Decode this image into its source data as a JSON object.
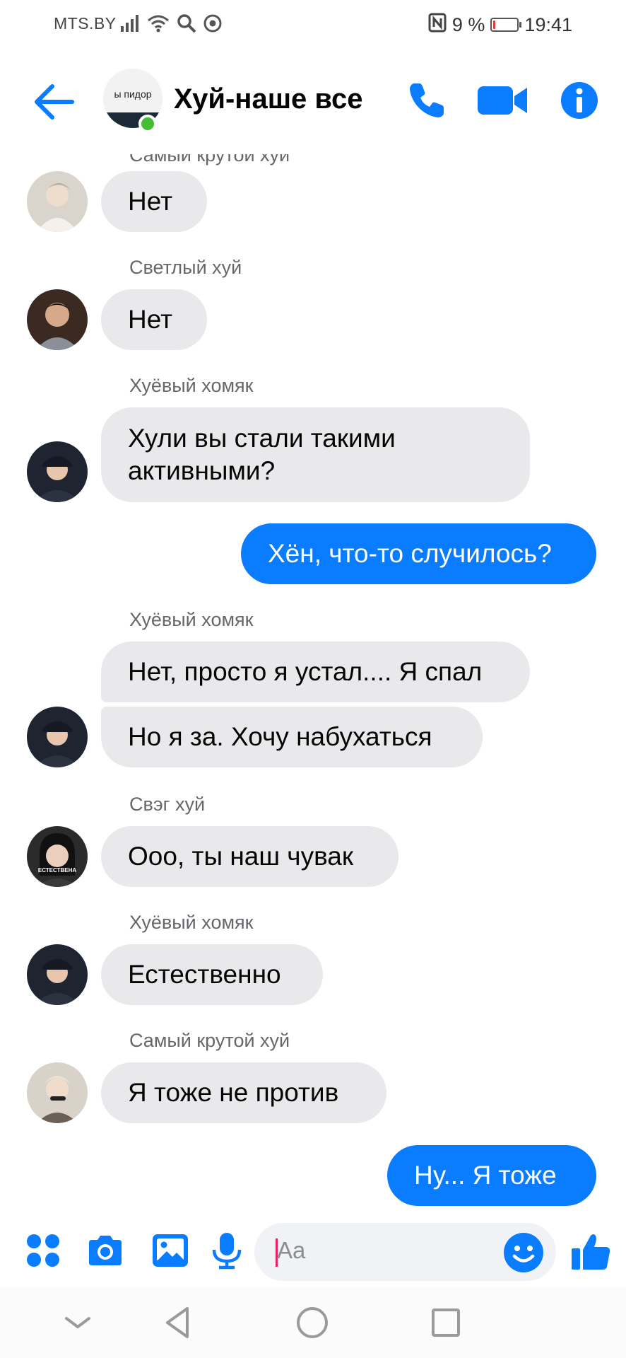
{
  "status_bar": {
    "carrier": "MTS.BY",
    "battery_text": "9 %",
    "battery_level": 0.09,
    "time": "19:41"
  },
  "header": {
    "back_icon": "arrow-left-icon",
    "avatar_text": "ы пидор",
    "title": "Хуй-наше все",
    "call_icon": "phone-icon",
    "video_icon": "video-camera-icon",
    "info_icon": "info-icon"
  },
  "colors": {
    "accent": "#0a7cff",
    "incoming_bubble": "#e9e9eb",
    "online": "#44bd32"
  },
  "messages": {
    "top_sender_partial": "Самый крутой хуй",
    "m1": {
      "text": "Нет"
    },
    "s2": "Светлый хуй",
    "m2": {
      "text": "Нет"
    },
    "s3": "Хуёвый хомяк",
    "m3": {
      "text": "Хули вы стали такими\nактивными?"
    },
    "m4": {
      "text": "Хён, что-то случилось?"
    },
    "s5": "Хуёвый хомяк",
    "m5": {
      "text": "Нет, просто я устал.... Я спал"
    },
    "m6": {
      "text": "Но я за. Хочу набухаться"
    },
    "s7": "Свэг хуй",
    "m7": {
      "text": "Ооо, ты наш чувак"
    },
    "avatar7_caption": "ЕСТЕСТВЕНА",
    "s8": "Хуёвый хомяк",
    "m8": {
      "text": "Естественно"
    },
    "s9": "Самый крутой хуй",
    "m9": {
      "text": "Я тоже не против"
    },
    "m10": {
      "text": "Ну... Я тоже"
    }
  },
  "composer": {
    "placeholder": "Aa",
    "actions": [
      "grid-menu-icon",
      "camera-icon",
      "gallery-icon",
      "microphone-icon",
      "emoji-icon",
      "thumbs-up-icon"
    ]
  },
  "navbar": {
    "buttons": [
      "chevron-down-icon",
      "back-triangle-icon",
      "home-circle-icon",
      "recents-square-icon"
    ]
  }
}
